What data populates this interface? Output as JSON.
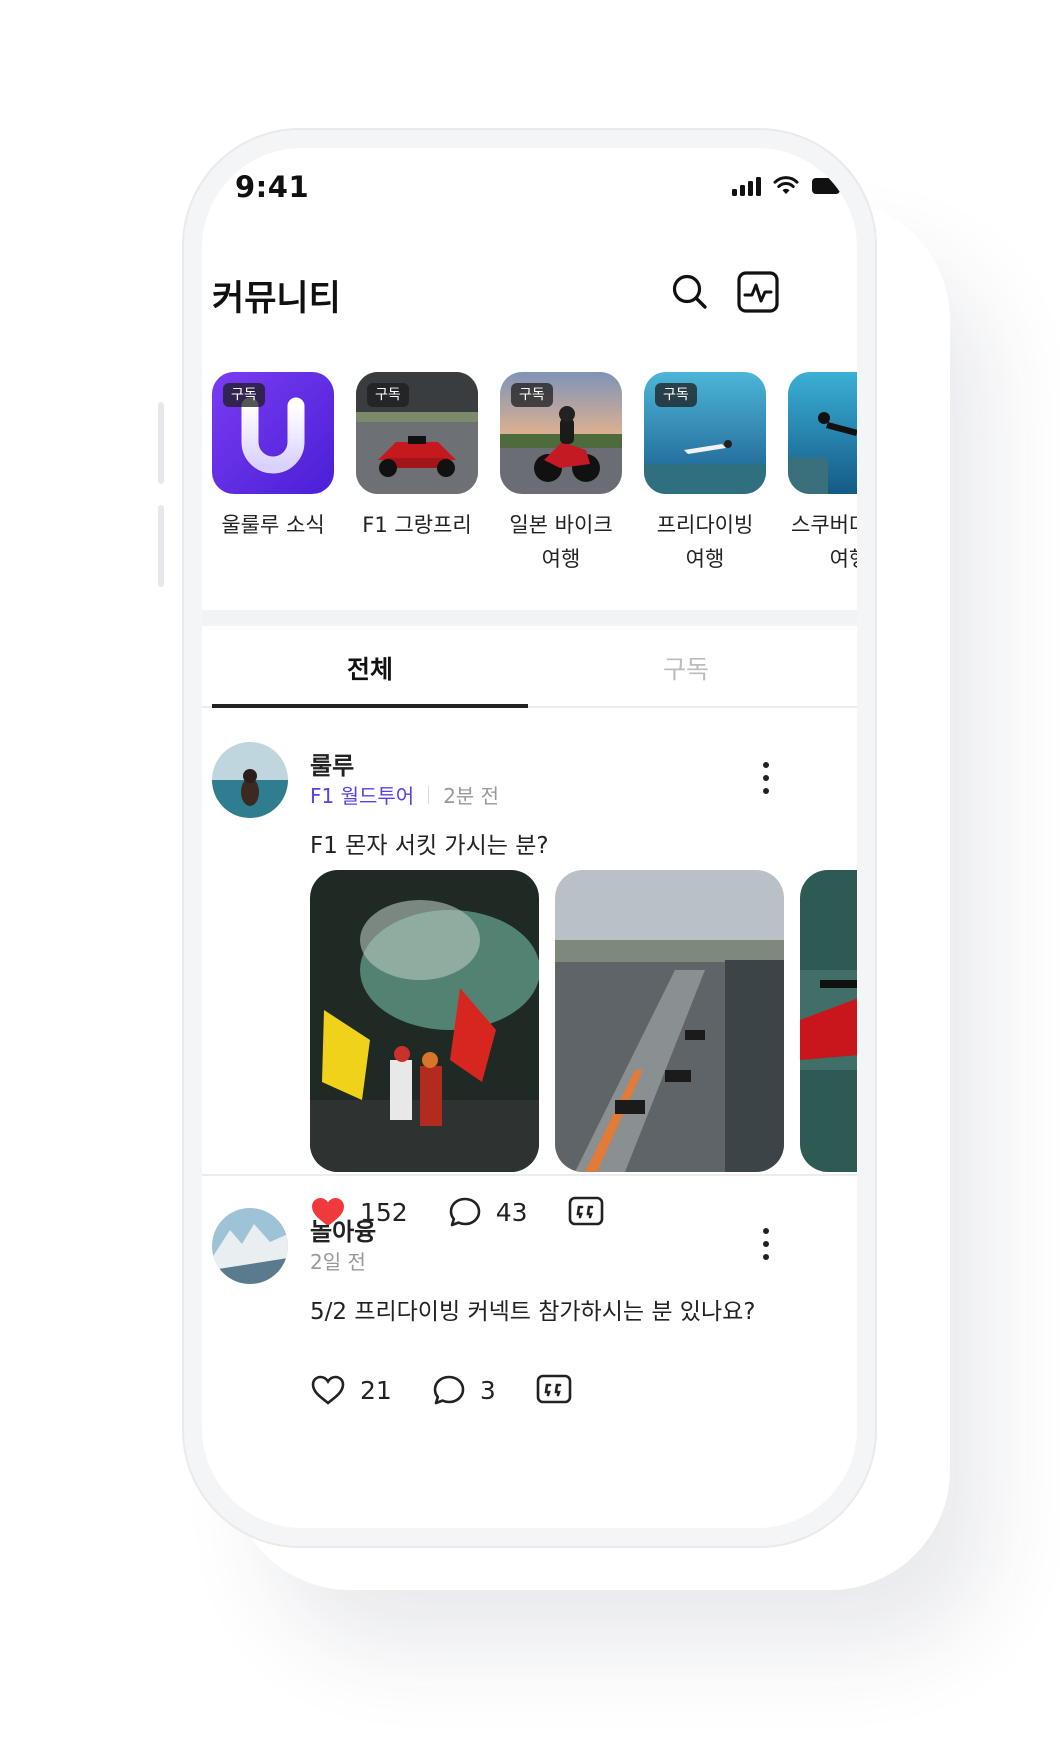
{
  "status_bar": {
    "time": "9:41"
  },
  "header": {
    "title": "커뮤니티"
  },
  "channels": [
    {
      "label": "울룰루 소식",
      "badge": "구독",
      "image": "app-logo-u"
    },
    {
      "label": "F1 그랑프리",
      "badge": "구독",
      "image": "f1-car-photo"
    },
    {
      "label": "일본 바이크 여행",
      "badge": "구독",
      "image": "motorbike-photo"
    },
    {
      "label": "프리다이빙 여행",
      "badge": "구독",
      "image": "freediving-photo"
    },
    {
      "label": "스쿠버다이빙 여행",
      "image": "scuba-photo"
    }
  ],
  "tabs": [
    {
      "label": "전체",
      "active": true
    },
    {
      "label": "구독",
      "active": false
    }
  ],
  "posts": [
    {
      "author": "룰루",
      "channel": "F1 월드투어",
      "time": "2분 전",
      "text": "F1 몬자 서킷 가시는 분?",
      "photos": [
        "ferrari-fans-photo",
        "pit-lane-photo",
        "red-f1-car-photo"
      ],
      "likes": "152",
      "liked": true,
      "comments": "43"
    },
    {
      "author": "놀아융",
      "time": "2일 전",
      "text": "5/2 프리다이빙 커넥트 참가하시는 분 있나요?",
      "likes": "21",
      "liked": false,
      "comments": "3"
    }
  ],
  "colors": {
    "accent": "#5b3fe6",
    "like": "#f0393c",
    "divider": "#ececec"
  }
}
